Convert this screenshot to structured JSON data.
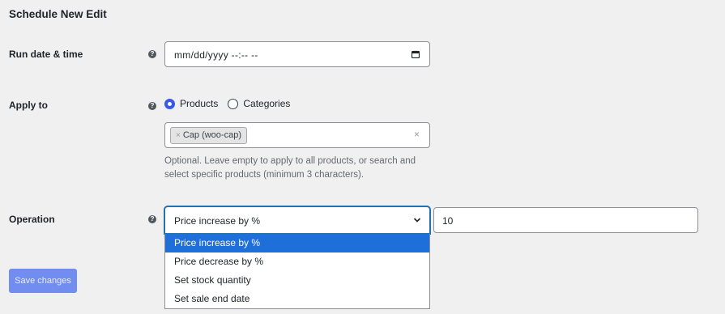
{
  "form": {
    "title": "Schedule New Edit",
    "run_date": {
      "label": "Run date & time",
      "help_glyph": "?",
      "value": "mm/dd/yyyy --:-- --",
      "icon": "calendar-icon"
    },
    "apply_to": {
      "label": "Apply to",
      "help_glyph": "?",
      "options": [
        {
          "label": "Products",
          "checked": true
        },
        {
          "label": "Categories",
          "checked": false
        }
      ],
      "selected_items": [
        {
          "remove": "×",
          "label": "Cap (woo-cap)"
        }
      ],
      "clear_glyph": "×",
      "help_text": "Optional. Leave empty to apply to all products, or search and select specific products (minimum 3 characters)."
    },
    "operation": {
      "label": "Operation",
      "help_glyph": "?",
      "selected": "Price increase by %",
      "value": "10",
      "options": [
        "Price increase by %",
        "Price decrease by %",
        "Set stock quantity",
        "Set sale end date"
      ],
      "highlighted_index": 0
    },
    "save_label": "Save changes"
  },
  "colors": {
    "accent": "#3858e9",
    "highlight": "#1e6fd9",
    "focus_border": "#2271b1",
    "button": "#5b7cf0"
  }
}
